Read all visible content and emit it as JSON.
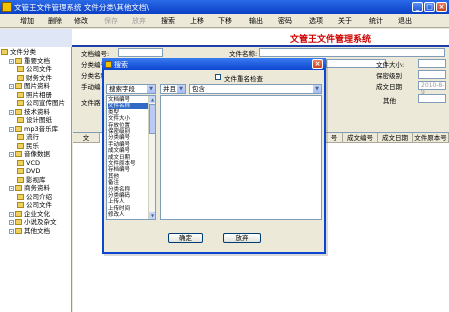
{
  "window": {
    "title": "文管王文件管理系统  文件分类\\其他文档\\"
  },
  "toolbar": {
    "items": [
      "增加",
      "删除",
      "修改",
      "保存",
      "放弃",
      "搜索",
      "上移",
      "下移",
      "输出",
      "密码",
      "选项",
      "关于",
      "统计",
      "退出"
    ],
    "disabled": [
      "保存",
      "放弃"
    ]
  },
  "banner": {
    "app_name": "文管王文件管理系统"
  },
  "tree": {
    "items": [
      {
        "label": "文件分类",
        "level": 0
      },
      {
        "label": "重要文档",
        "level": 1
      },
      {
        "label": "公司文件",
        "level": 2
      },
      {
        "label": "财务文件",
        "level": 2
      },
      {
        "label": "图片资料",
        "level": 1
      },
      {
        "label": "照片相册",
        "level": 2
      },
      {
        "label": "公司宣传图片",
        "level": 2
      },
      {
        "label": "技术资料",
        "level": 1
      },
      {
        "label": "设计图纸",
        "level": 2
      },
      {
        "label": "mp3音乐库",
        "level": 1
      },
      {
        "label": "流行",
        "level": 2
      },
      {
        "label": "民乐",
        "level": 2
      },
      {
        "label": "音像数据",
        "level": 1
      },
      {
        "label": "VCD",
        "level": 2
      },
      {
        "label": "DVD",
        "level": 2
      },
      {
        "label": "影视库",
        "level": 2
      },
      {
        "label": "商务资料",
        "level": 1
      },
      {
        "label": "公司介绍",
        "level": 2
      },
      {
        "label": "公司文件",
        "level": 2
      },
      {
        "label": "企业文化",
        "level": 1
      },
      {
        "label": "小说及杂文",
        "level": 1
      },
      {
        "label": "其他文档",
        "level": 1
      }
    ]
  },
  "form": {
    "file_no_label": "文档编号:",
    "file_name_label": "文件名称:",
    "class_no_label": "分类编号",
    "class_name_label": "分类名称",
    "manual_label": "手动编",
    "file_size_label": "文件大小:",
    "security_label": "保密级别",
    "date_label": "成文日期",
    "date_value": "2010-8-9",
    "other_label": "其他",
    "file_path_label": "文件路",
    "add_btn": "增加",
    "del_btn": "删除"
  },
  "grid": {
    "headers": [
      "文",
      "号",
      "成文编号",
      "成文日期",
      "文件原本号"
    ]
  },
  "dialog": {
    "title": "搜索",
    "checkbox_label": "文件重名检查",
    "field_combo": "搜索字段",
    "logic_combo": "并且",
    "op_combo": "包含",
    "fields": [
      "文档编号",
      "文件名称",
      "类型",
      "文件大小",
      "存放位置",
      "保密级别",
      "分类编号",
      "手动编号",
      "成文编号",
      "成文日期",
      "文件原本号",
      "存档编号",
      "其他",
      "备注",
      "分类名称",
      "分类编码",
      "上传人",
      "上传时间",
      "修改人"
    ],
    "selected_index": 1,
    "ok_btn": "确定",
    "cancel_btn": "放弃"
  }
}
